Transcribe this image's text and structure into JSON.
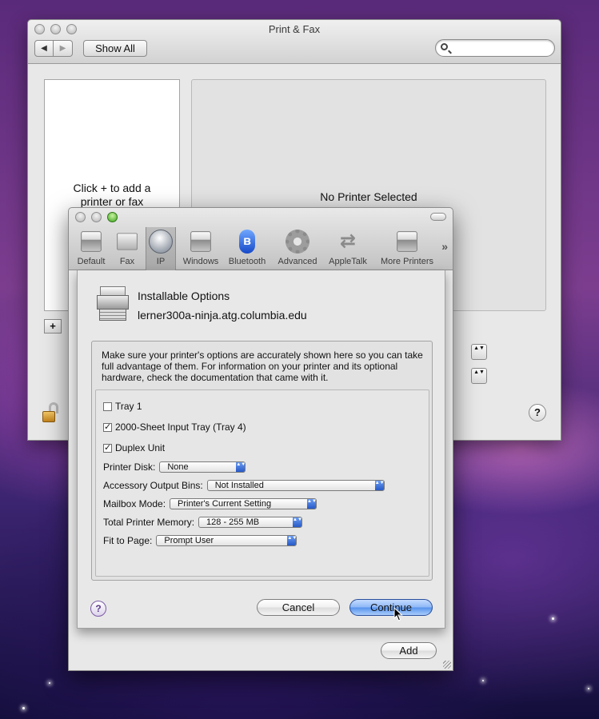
{
  "print_fax": {
    "title": "Print & Fax",
    "back_glyph": "◀",
    "forward_glyph": "▶",
    "show_all": "Show All",
    "search_placeholder": "",
    "list_hint_line1": "Click + to add a",
    "list_hint_line2": "printer or fax",
    "no_printer": "No Printer Selected",
    "add_glyph": "+",
    "help_glyph": "?",
    "stepper_glyph": "▲▼"
  },
  "add_printer": {
    "toolbar": [
      {
        "label": "Default",
        "icon": "printer-icon"
      },
      {
        "label": "Fax",
        "icon": "fax-icon"
      },
      {
        "label": "IP",
        "icon": "globe-icon"
      },
      {
        "label": "Windows",
        "icon": "printer-icon"
      },
      {
        "label": "Bluetooth",
        "icon": "bluetooth-icon"
      },
      {
        "label": "Advanced",
        "icon": "gear-icon"
      },
      {
        "label": "AppleTalk",
        "icon": "arrows-icon"
      },
      {
        "label": "More Printers",
        "icon": "printer-icon"
      }
    ],
    "bluetooth_glyph": "ʙ",
    "appletalk_glyph": "⇄",
    "more_glyph": "»",
    "add_button": "Add"
  },
  "sheet": {
    "title": "Installable Options",
    "host": "lerner300a-ninja.atg.columbia.edu",
    "description": "Make sure your printer's options are accurately shown here so you can take full advantage of them.  For information on your printer and its optional hardware, check the documentation that came with it.",
    "options": {
      "tray1": {
        "label": "Tray 1",
        "checked": false
      },
      "tray4": {
        "label": "2000-Sheet Input Tray (Tray 4)",
        "checked": true
      },
      "duplex": {
        "label": "Duplex Unit",
        "checked": true
      },
      "printer_disk": {
        "label": "Printer Disk:",
        "value": "None"
      },
      "output_bins": {
        "label": "Accessory Output Bins:",
        "value": "Not Installed"
      },
      "mailbox": {
        "label": "Mailbox Mode:",
        "value": "Printer's Current Setting"
      },
      "memory": {
        "label": "Total Printer Memory:",
        "value": "128 - 255 MB"
      },
      "fit": {
        "label": "Fit to Page:",
        "value": "Prompt User"
      }
    },
    "check_glyph": "✓",
    "popup_glyph": "▲▼",
    "help_glyph": "?",
    "cancel": "Cancel",
    "continue": "Continue"
  },
  "colors": {
    "default_button": "#5592ec",
    "accent_blue": "#2659c6"
  }
}
